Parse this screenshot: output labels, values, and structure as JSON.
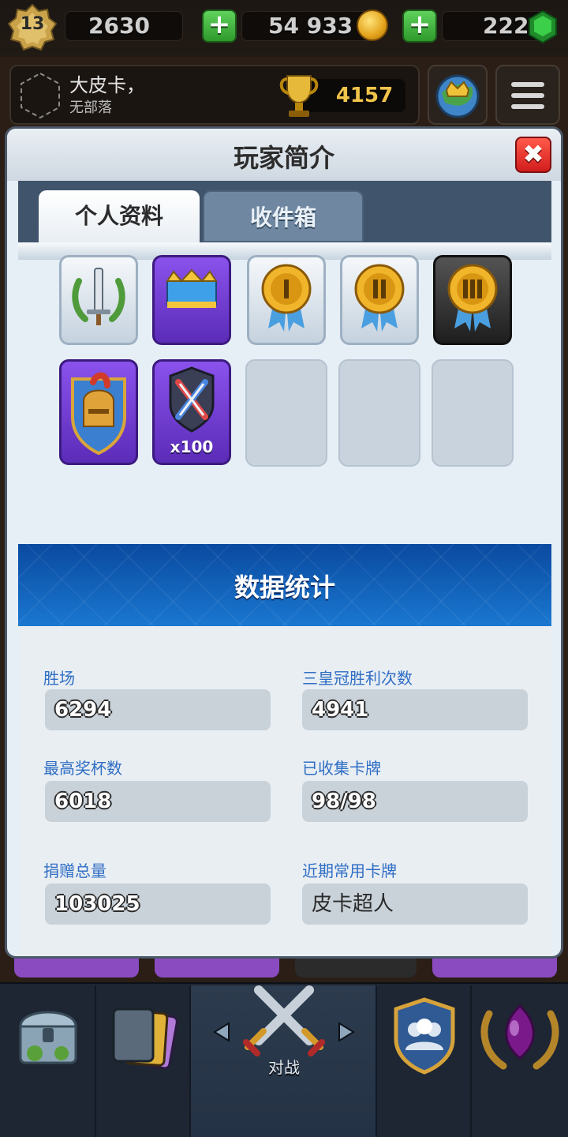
{
  "topbar": {
    "level": "13",
    "gold_pill": "2630",
    "coins": "54 933",
    "gems": "222",
    "add_icon": "plus-icon",
    "coin_icon": "gold-coin-icon",
    "gem_icon": "green-gem-icon"
  },
  "player": {
    "name": "大皮卡，",
    "clan": "无部落",
    "trophies": "4157",
    "trophy_icon": "trophy-icon"
  },
  "panel": {
    "title": "玩家简介",
    "close_label": "✖",
    "tabs": [
      {
        "label": "个人资料",
        "active": true
      },
      {
        "label": "收件箱",
        "active": false
      }
    ]
  },
  "badges": [
    {
      "icon": "laurel-sword-icon",
      "style": "silver"
    },
    {
      "icon": "crown-icon",
      "style": "purple"
    },
    {
      "icon": "medal-i-icon",
      "style": "silver"
    },
    {
      "icon": "medal-ii-icon",
      "style": "silver"
    },
    {
      "icon": "medal-iii-icon",
      "style": "dark"
    },
    {
      "icon": "knight-helmet-icon",
      "style": "purple"
    },
    {
      "icon": "crossed-swords-shield-icon",
      "style": "purple",
      "label": "x100"
    },
    {
      "style": "empty"
    },
    {
      "style": "empty"
    },
    {
      "style": "empty"
    }
  ],
  "stats": {
    "title": "数据统计",
    "items": [
      {
        "label": "胜场",
        "value": "6294"
      },
      {
        "label": "三皇冠胜利次数",
        "value": "4941"
      },
      {
        "label": "最高奖杯数",
        "value": "6018"
      },
      {
        "label": "已收集卡牌",
        "value": "98/98"
      },
      {
        "label": "捐赠总量",
        "value": "103025"
      },
      {
        "label": "近期常用卡牌",
        "value": "皮卡超人"
      }
    ]
  },
  "bottom_nav": {
    "items": [
      {
        "icon": "chest-icon"
      },
      {
        "icon": "cards-icon"
      },
      {
        "icon": "crossed-swords-icon",
        "label": "对战",
        "active": true
      },
      {
        "icon": "clan-shield-icon"
      },
      {
        "icon": "laurel-trophy-icon"
      }
    ],
    "arrow_left": "chevron-left-icon",
    "arrow_right": "chevron-right-icon"
  },
  "colors": {
    "accent_blue": "#2f6ec4",
    "stats_header": "#0a4aa0",
    "close_red": "#d21d1d",
    "trophy_gold": "#f1c44a"
  }
}
